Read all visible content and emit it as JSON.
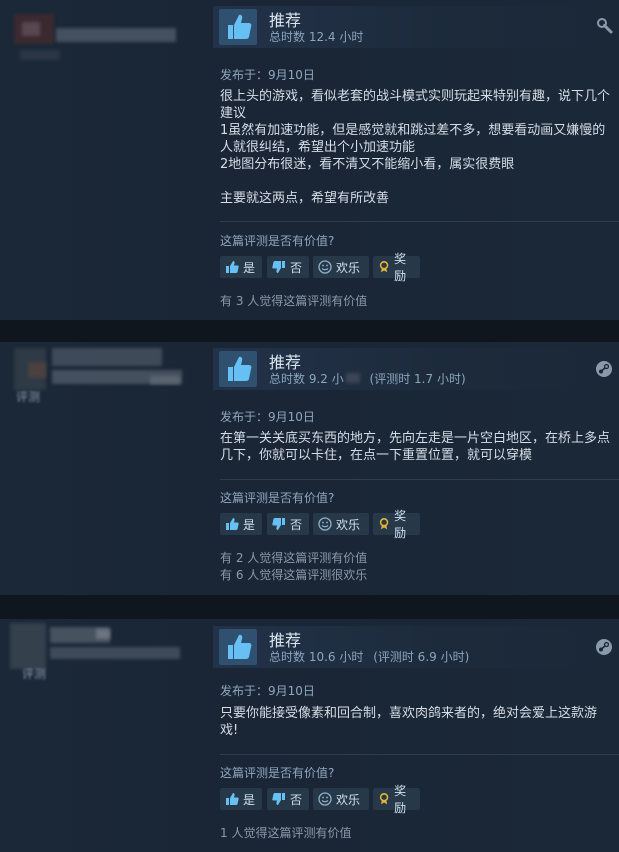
{
  "reviews": [
    {
      "recommendation": "推荐",
      "hours": "总时数 12.4 小时",
      "posted": "发布于：9月10日",
      "body": [
        "很上头的游戏，看似老套的战斗模式实则玩起来特别有趣，说下几个建议",
        "1虽然有加速功能，但是感觉就和跳过差不多，想要看动画又嫌慢的人就很纠结，希望出个小加速功能",
        "2地图分布很迷，看不清又不能缩小看，属实很费眼",
        "",
        "主要就这两点，希望有所改善"
      ],
      "helpful_question": "这篇评测是否有价值?",
      "buttons": {
        "yes": "是",
        "no": "否",
        "funny": "欢乐",
        "award": "奖励"
      },
      "stats": [
        "有 3 人觉得这篇评测有价值"
      ],
      "corner_icon": "wrench-icon"
    },
    {
      "recommendation": "推荐",
      "hours": "总时数 9.2 小",
      "hours_extra": "(评测时 1.7 小时)",
      "user_fragment": "评测",
      "posted": "发布于：9月10日",
      "body": [
        "在第一关关底买东西的地方，先向左走是一片空白地区，在桥上多点几下，你就可以卡住，在点一下重置位置，就可以穿模"
      ],
      "helpful_question": "这篇评测是否有价值?",
      "buttons": {
        "yes": "是",
        "no": "否",
        "funny": "欢乐",
        "award": "奖励"
      },
      "stats": [
        "有 2 人觉得这篇评测有价值",
        "有 6 人觉得这篇评测很欢乐"
      ],
      "corner_icon": "steam-icon"
    },
    {
      "recommendation": "推荐",
      "hours": "总时数 10.6 小时",
      "hours_extra": "(评测时 6.9 小时)",
      "user_fragment": "评测",
      "posted": "发布于：9月10日",
      "body": [
        "只要你能接受像素和回合制，喜欢肉鸽来者的，绝对会爱上这款游戏!"
      ],
      "helpful_question": "这篇评测是否有价值?",
      "buttons": {
        "yes": "是",
        "no": "否",
        "funny": "欢乐",
        "award": "奖励"
      },
      "stats": [
        "1 人觉得这篇评测有价值"
      ],
      "corner_icon": "steam-icon"
    }
  ],
  "colors": {
    "background": "#1b2838",
    "accent_thumb": "#66c0f4",
    "award_gold": "#e0b53a"
  }
}
